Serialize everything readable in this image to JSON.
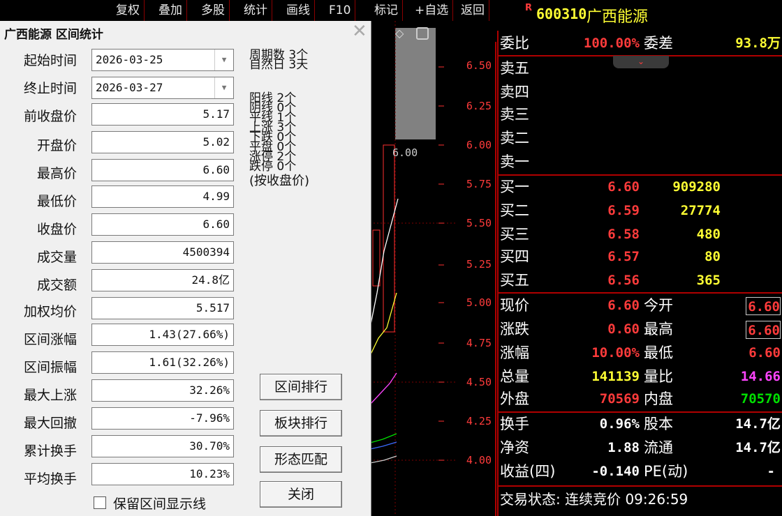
{
  "toolbar": {
    "items": [
      "复权",
      "叠加",
      "多股",
      "统计",
      "画线",
      "F10",
      "标记",
      "+自选",
      "返回"
    ]
  },
  "stock": {
    "badge": "R",
    "code": "600310",
    "name": "广西能源"
  },
  "chart": {
    "price_labels": [
      "6.50",
      "6.25",
      "6.00",
      "5.75",
      "5.50",
      "5.25",
      "5.00",
      "4.75",
      "4.50",
      "4.25",
      "4.00"
    ],
    "cursor_price": "6.00",
    "diamond_icon": "diamond-icon",
    "panel_icon": "panel-toggle-icon"
  },
  "quote": {
    "weibi_label": "委比",
    "weibi_value": "100.00%",
    "weicha_label": "委差",
    "weicha_value": "93.8万",
    "sell": [
      {
        "label": "卖五",
        "price": "",
        "vol": ""
      },
      {
        "label": "卖四",
        "price": "",
        "vol": ""
      },
      {
        "label": "卖三",
        "price": "",
        "vol": ""
      },
      {
        "label": "卖二",
        "price": "",
        "vol": ""
      },
      {
        "label": "卖一",
        "price": "",
        "vol": ""
      }
    ],
    "buy": [
      {
        "label": "买一",
        "price": "6.60",
        "vol": "909280"
      },
      {
        "label": "买二",
        "price": "6.59",
        "vol": "27774"
      },
      {
        "label": "买三",
        "price": "6.58",
        "vol": "480"
      },
      {
        "label": "买四",
        "price": "6.57",
        "vol": "80"
      },
      {
        "label": "买五",
        "price": "6.56",
        "vol": "365"
      }
    ],
    "stats": [
      {
        "l1": "现价",
        "v1": "6.60",
        "l2": "今开",
        "v2": "6.60"
      },
      {
        "l1": "涨跌",
        "v1": "0.60",
        "l2": "最高",
        "v2": "6.60"
      },
      {
        "l1": "涨幅",
        "v1": "10.00%",
        "l2": "最低",
        "v2": "6.60"
      },
      {
        "l1": "总量",
        "v1": "141139",
        "l2": "量比",
        "v2": "14.66"
      },
      {
        "l1": "外盘",
        "v1": "70569",
        "l2": "内盘",
        "v2": "70570"
      }
    ],
    "stats2": [
      {
        "l1": "换手",
        "v1": "0.96%",
        "l2": "股本",
        "v2": "14.7亿"
      },
      {
        "l1": "净资",
        "v1": "1.88",
        "l2": "流通",
        "v2": "14.7亿"
      },
      {
        "l1": "收益(四)",
        "v1": "-0.140",
        "l2": "PE(动)",
        "v2": "-"
      }
    ],
    "status": "交易状态: 连续竞价 09:26:59"
  },
  "dialog": {
    "title": "广西能源 区间统计",
    "start_label": "起始时间",
    "start_value": "2026-03-25",
    "end_label": "终止时间",
    "end_value": "2026-03-27",
    "fields": [
      {
        "label": "前收盘价",
        "value": "5.17"
      },
      {
        "label": "开盘价",
        "value": "5.02"
      },
      {
        "label": "最高价",
        "value": "6.60"
      },
      {
        "label": "最低价",
        "value": "4.99"
      },
      {
        "label": "收盘价",
        "value": "6.60"
      },
      {
        "label": "成交量",
        "value": "4500394"
      },
      {
        "label": "成交额",
        "value": "24.8亿"
      },
      {
        "label": "加权均价",
        "value": "5.517"
      },
      {
        "label": "区间涨幅",
        "value": "1.43(27.66%)"
      },
      {
        "label": "区间振幅",
        "value": "1.61(32.26%)"
      },
      {
        "label": "最大上涨",
        "value": "32.26%"
      },
      {
        "label": "最大回撤",
        "value": "-7.96%"
      },
      {
        "label": "累计换手",
        "value": "30.70%"
      },
      {
        "label": "平均换手",
        "value": "10.23%"
      }
    ],
    "period": {
      "l1": "周期数",
      "v1": "3个",
      "l2": "自然日",
      "v2": "3天"
    },
    "counts": [
      {
        "label": "阳线",
        "value": "2个"
      },
      {
        "label": "阴线",
        "value": "0个"
      },
      {
        "label": "平线",
        "value": "1个"
      },
      {
        "label": "上涨",
        "value": "3个"
      },
      {
        "label": "下跌",
        "value": "0个"
      },
      {
        "label": "平盘",
        "value": "0个"
      },
      {
        "label": "涨停",
        "value": "2个"
      },
      {
        "label": "跌停",
        "value": "0个"
      }
    ],
    "counts_note": "(按收盘价)",
    "buttons": [
      "区间排行",
      "板块排行",
      "形态匹配",
      "关闭"
    ],
    "checkbox_label": "保留区间显示线"
  }
}
